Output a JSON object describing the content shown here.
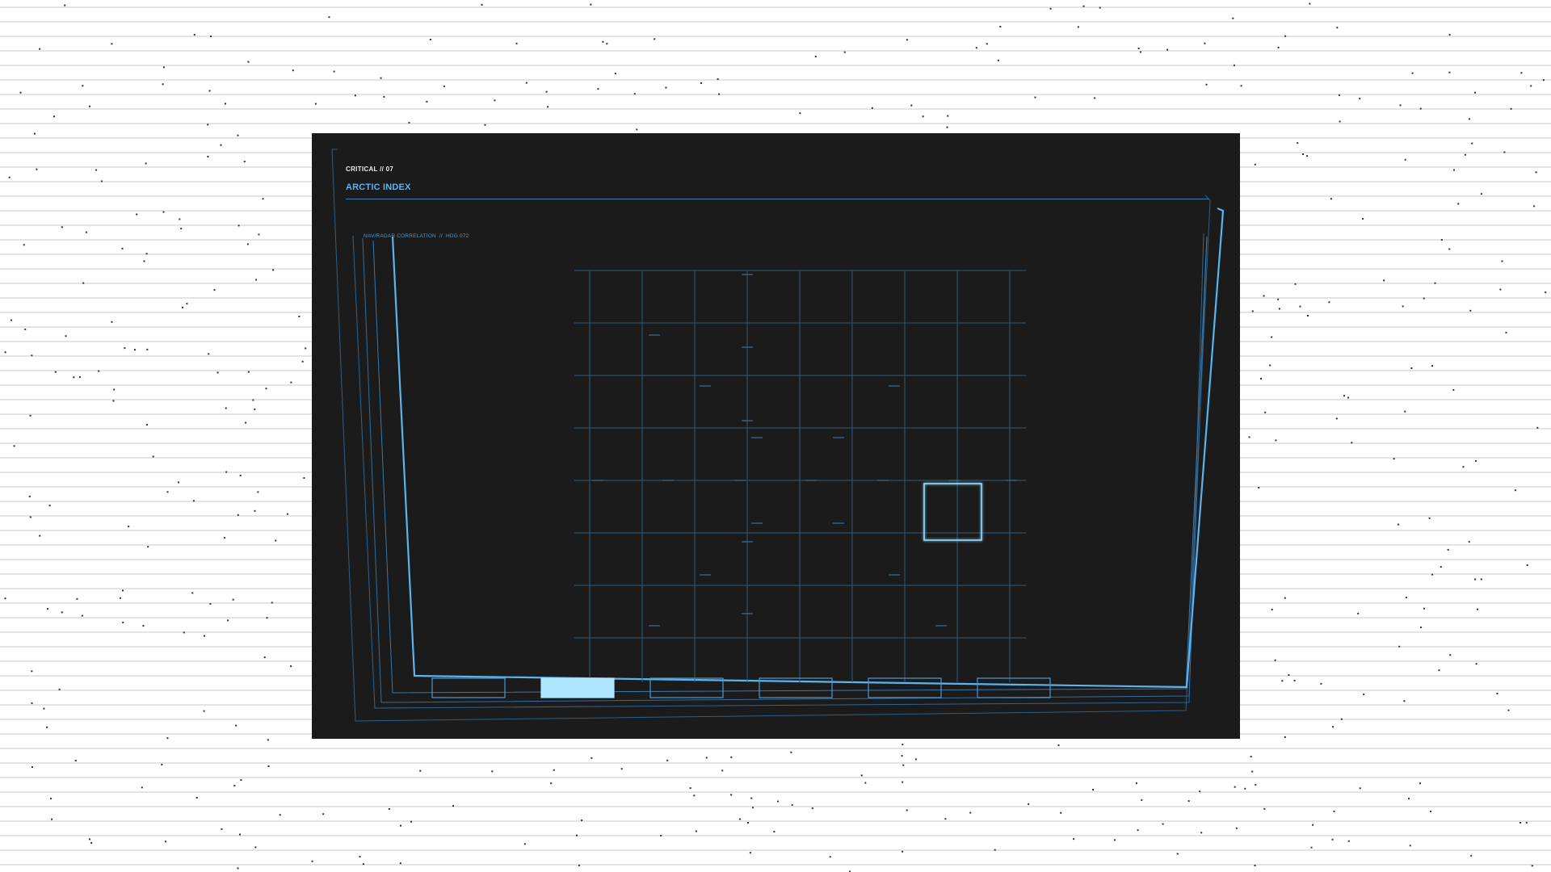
{
  "header": {
    "code": "CRITICAL // 07",
    "title": "ARCTIC INDEX"
  },
  "scope": {
    "label": "NAV/RADAR CORRELATION  //  HDG 072",
    "selected_tab_index": 1,
    "tab_count": 6
  },
  "colors": {
    "page_background": "#ffffff",
    "panel_background": "#1b1b1b",
    "accent": "#5ab4f0",
    "accent_bright": "#8fdcff",
    "grid": "#2f5878",
    "scanline": "#c8c8c8"
  }
}
